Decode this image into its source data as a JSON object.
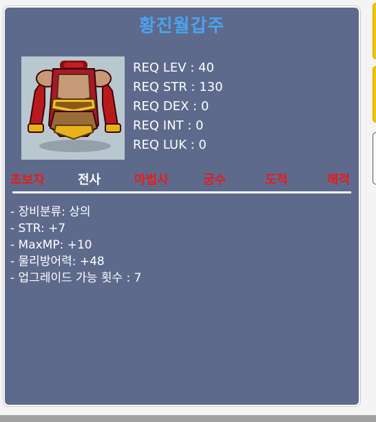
{
  "item": {
    "name": "황진월갑주",
    "image_icon": "red-gold-armor-icon",
    "requirements": [
      "REQ LEV : 40",
      "REQ STR : 130",
      "REQ DEX : 0",
      "REQ INT : 0",
      "REQ LUK : 0"
    ],
    "jobs": [
      {
        "label": "초보자",
        "color": "#e81b1b"
      },
      {
        "label": "전사",
        "color": "#ffffff"
      },
      {
        "label": "마법사",
        "color": "#e81b1b"
      },
      {
        "label": "궁수",
        "color": "#e81b1b"
      },
      {
        "label": "도적",
        "color": "#e81b1b"
      },
      {
        "label": "해적",
        "color": "#e81b1b"
      }
    ],
    "stats": [
      "- 장비분류: 상의",
      "- STR: +7",
      "- MaxMP: +10",
      "- 물리방어력: +48",
      "- 업그레이드 가능 횟수 : 7"
    ]
  },
  "colors": {
    "panel_bg": "#5e6a8c",
    "title": "#4aa3ef",
    "available_job": "#ffffff",
    "unavailable_job": "#e81b1b"
  }
}
